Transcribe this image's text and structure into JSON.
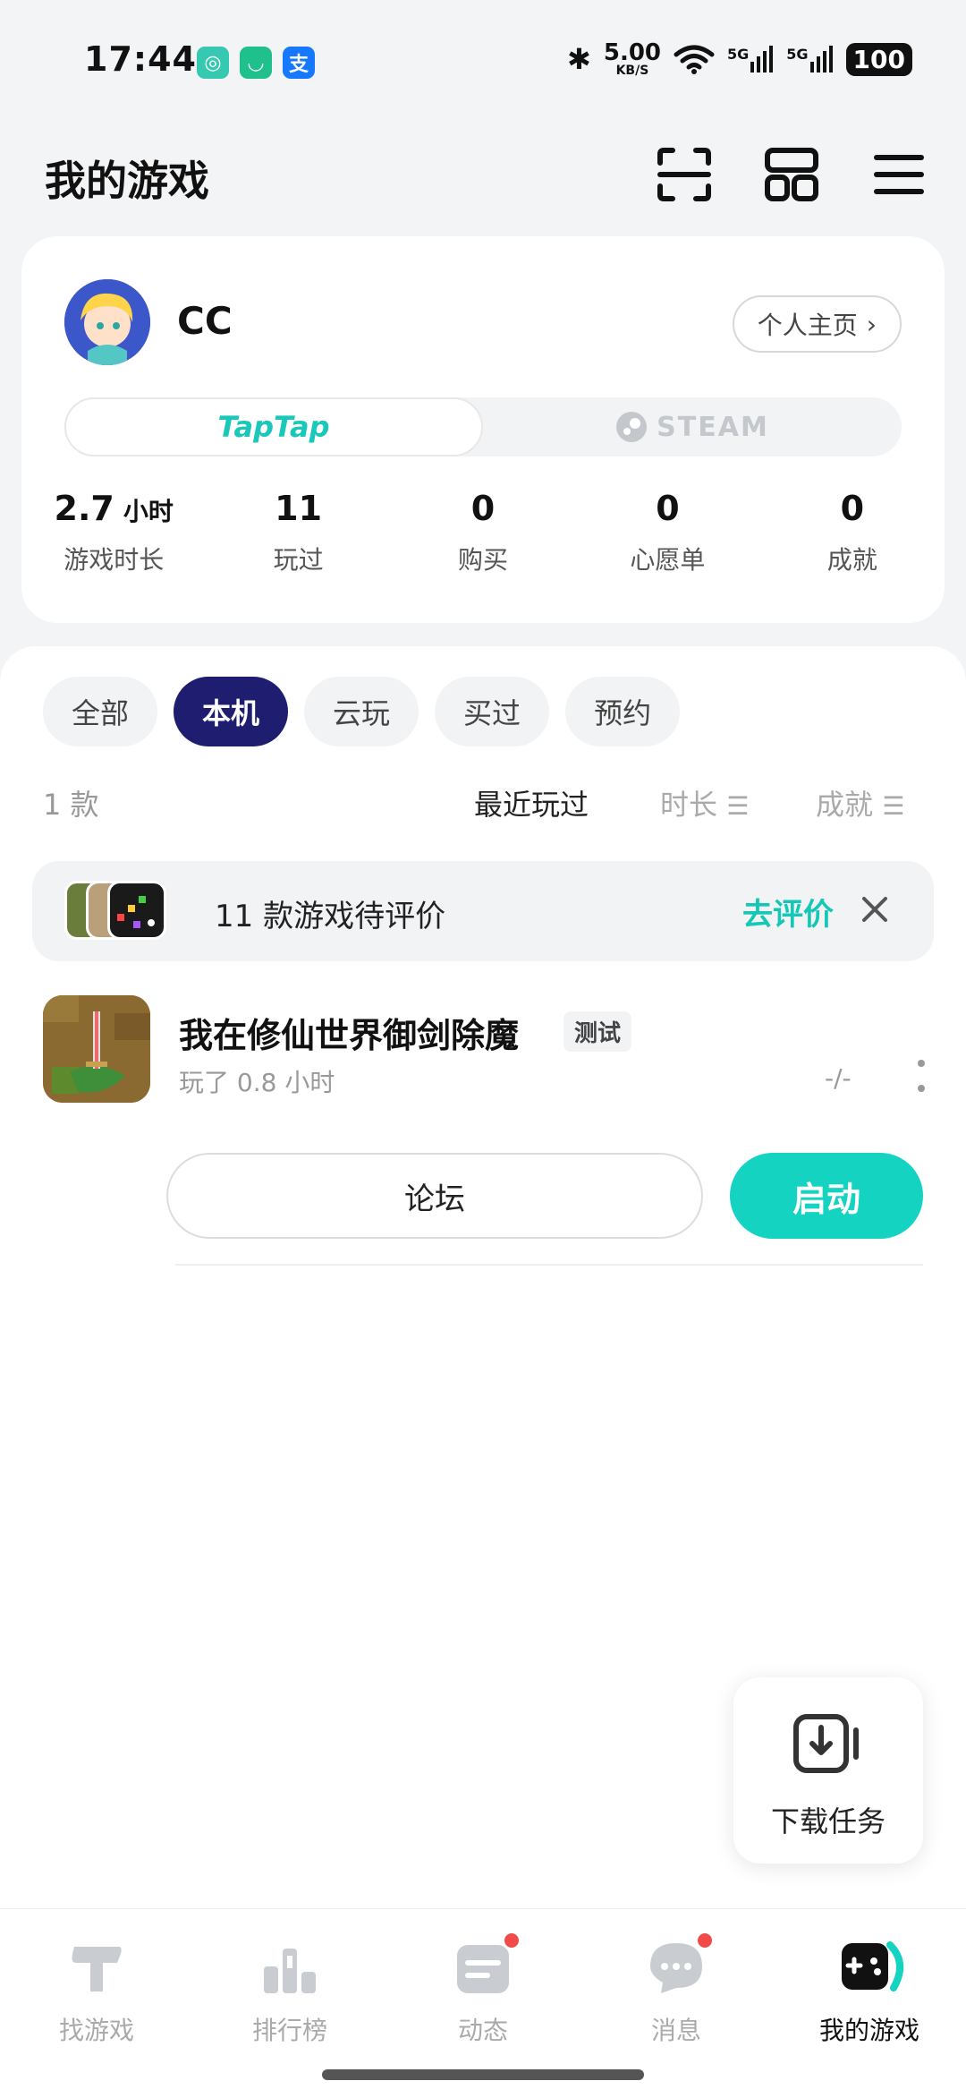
{
  "status_bar": {
    "time": "17:44",
    "net_speed_value": "5.00",
    "net_speed_unit": "KB/S",
    "signal1": "5G",
    "signal2": "5G",
    "battery": "100"
  },
  "header": {
    "title": "我的游戏"
  },
  "profile": {
    "username": "CC",
    "homepage_label": "个人主页",
    "platform_tabs": [
      "TapTap",
      "STEAM"
    ],
    "stats": [
      {
        "value": "2.7",
        "unit": "小时",
        "label": "游戏时长"
      },
      {
        "value": "11",
        "label": "玩过"
      },
      {
        "value": "0",
        "label": "购买"
      },
      {
        "value": "0",
        "label": "心愿单"
      },
      {
        "value": "0",
        "label": "成就"
      }
    ]
  },
  "filters": {
    "chips": [
      "全部",
      "本机",
      "云玩",
      "买过",
      "预约"
    ],
    "active": "本机"
  },
  "sort": {
    "count": "1 款",
    "recent": "最近玩过",
    "duration": "时长",
    "achievement": "成就"
  },
  "review_banner": {
    "text": "11 款游戏待评价",
    "action": "去评价"
  },
  "game": {
    "title": "我在修仙世界御剑除魔",
    "badge": "测试",
    "played": "玩了 0.8 小时",
    "score": "-/-",
    "forum_label": "论坛",
    "launch_label": "启动"
  },
  "download_fab": {
    "label": "下载任务"
  },
  "bottom_nav": {
    "items": [
      "找游戏",
      "排行榜",
      "动态",
      "消息",
      "我的游戏"
    ],
    "active_index": 4
  },
  "colors": {
    "accent": "#14d3c0",
    "active_chip": "#1e1d6f",
    "badge_red": "#f04a4a"
  }
}
